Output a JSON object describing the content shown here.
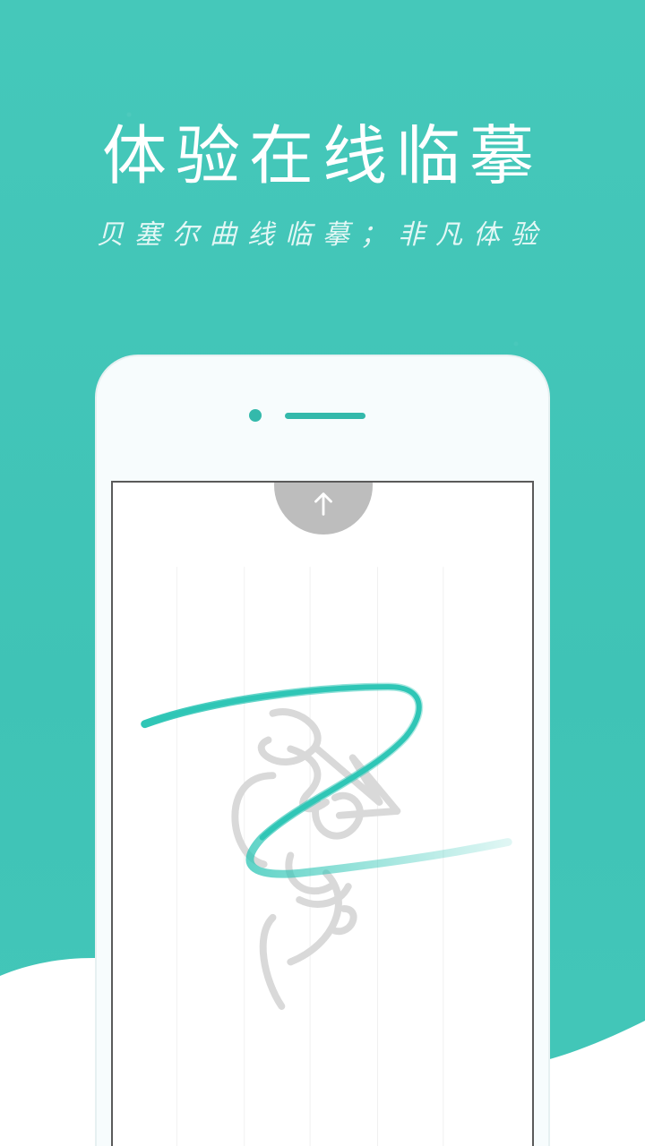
{
  "title": "体验在线临摹",
  "subtitle": "贝塞尔曲线临摹；非凡体验",
  "colors": {
    "accent": "#43c7b9",
    "stroke": "#2fc6b6",
    "ghost": "#d9d9d9",
    "button": "#bdbdbd",
    "white": "#ffffff"
  },
  "icons": {
    "up": "arrow-up-icon"
  }
}
